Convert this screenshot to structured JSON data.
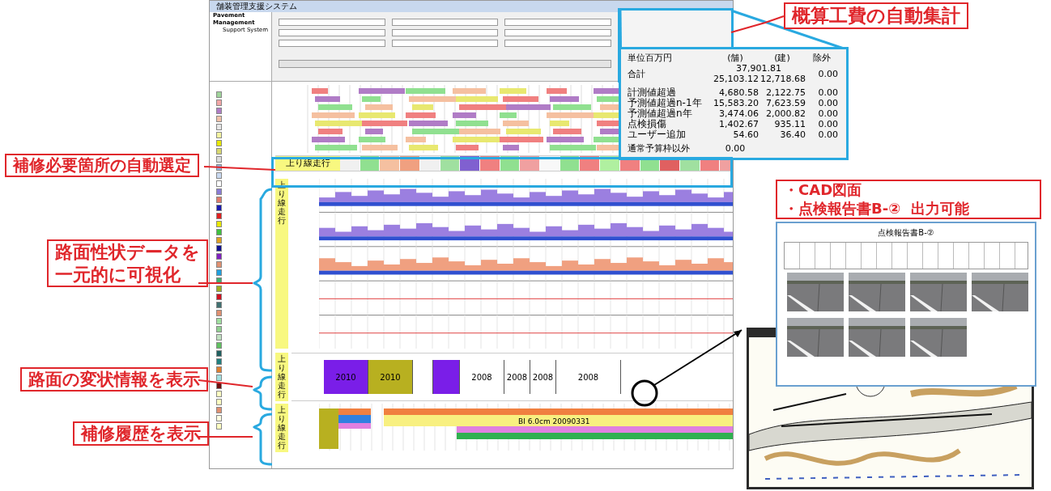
{
  "app": {
    "title": "舗装管理支援システム",
    "brand": [
      "Pavement Management",
      "Support System"
    ],
    "legend": [
      {
        "color": "#9fd49a"
      },
      {
        "color": "#f2a6a6"
      },
      {
        "color": "#b07cc6"
      },
      {
        "color": "#f0c0a8"
      },
      {
        "color": "#e6e6e6"
      },
      {
        "color": "#f4f4a0"
      },
      {
        "color": "#e8e800"
      },
      {
        "color": "#d8d870"
      },
      {
        "color": "#dddddd"
      },
      {
        "color": "#8fb4e0"
      },
      {
        "color": "#c8d8f0"
      },
      {
        "color": "#ffffff"
      },
      {
        "color": "#8a7cd6"
      },
      {
        "color": "#e07a6a"
      },
      {
        "color": "#1a1ab0"
      },
      {
        "color": "#e02020"
      },
      {
        "color": "#e8e800"
      },
      {
        "color": "#40c040"
      },
      {
        "color": "#e0a020"
      },
      {
        "color": "#101090"
      },
      {
        "color": "#8020c0"
      },
      {
        "color": "#e09070"
      },
      {
        "color": "#20a0e0"
      },
      {
        "color": "#40b070"
      },
      {
        "color": "#a0b020"
      },
      {
        "color": "#d01020"
      },
      {
        "color": "#407070"
      },
      {
        "color": "#e09070"
      },
      {
        "color": "#a0e0a0"
      },
      {
        "color": "#90d090"
      },
      {
        "color": "#c0e0c0"
      },
      {
        "color": "#60c060"
      },
      {
        "color": "#206060"
      },
      {
        "color": "#208080"
      },
      {
        "color": "#e08030"
      },
      {
        "color": "#a0e0e0"
      },
      {
        "color": "#701010"
      },
      {
        "color": "#ffffc0"
      },
      {
        "color": "#ffffc0"
      },
      {
        "color": "#e09070"
      },
      {
        "color": "#ffffe0"
      },
      {
        "color": "#ffffc0"
      }
    ],
    "repair_plan": {
      "lane": "上り線走行",
      "segments": [
        {
          "color": "#f0f0f0"
        },
        {
          "color": "#90e090"
        },
        {
          "color": "#f5c0a0"
        },
        {
          "color": "#f0a080"
        },
        {
          "color": "#f0f0f0"
        },
        {
          "color": "#a0e0a0"
        },
        {
          "color": "#8060d0"
        },
        {
          "color": "#f08080"
        },
        {
          "color": "#90e090"
        },
        {
          "color": "#f0a0a0"
        },
        {
          "color": "#f8f8f8"
        },
        {
          "color": "#90e090"
        },
        {
          "color": "#f08080"
        },
        {
          "color": "#b0f0a0"
        },
        {
          "color": "#f08080"
        },
        {
          "color": "#90e090"
        },
        {
          "color": "#e06060"
        },
        {
          "color": "#a0e0a0"
        },
        {
          "color": "#f08080"
        },
        {
          "color": "#f0a0a0"
        }
      ]
    },
    "survey": {
      "lane": "上り線走行"
    },
    "deformation": {
      "lane": "上り線走行",
      "blocks": [
        {
          "label": "2010",
          "color": "#7a1ee8"
        },
        {
          "label": "2010",
          "color": "#b8b020"
        },
        {
          "color": "#ffffff"
        },
        {
          "color": "#7a1ee8"
        },
        {
          "label": "2008",
          "color": "#ffffff"
        },
        {
          "label": "2008",
          "color": "#ffffff"
        },
        {
          "label": "2008",
          "color": "#ffffff"
        },
        {
          "label": "2008",
          "color": "#ffffff"
        }
      ]
    },
    "history": {
      "lane": "上り線走行",
      "label": "BI 6.0cm 20090331"
    }
  },
  "cost_summary": {
    "header": [
      "単位百万円",
      "(舗)",
      "(建)",
      "除外"
    ],
    "total_label": "合計",
    "total_combined": "37,901.81",
    "total_values": [
      "25,103.12",
      "12,718.68"
    ],
    "total_excluded": "0.00",
    "rows": [
      {
        "label": "計測値超過",
        "values": [
          "4,680.58",
          "2,122.75",
          "0.00"
        ]
      },
      {
        "label": "予測値超過n-1年",
        "values": [
          "15,583.20",
          "7,623.59",
          "0.00"
        ]
      },
      {
        "label": "予測値超過n年",
        "values": [
          "3,474.06",
          "2,000.82",
          "0.00"
        ]
      },
      {
        "label": "点検損傷",
        "values": [
          "1,402.67",
          "935.11",
          "0.00"
        ]
      },
      {
        "label": "ユーザー追加",
        "values": [
          "54.60",
          "36.40",
          "0.00"
        ]
      }
    ],
    "footer_label": "通常予算枠以外",
    "footer_value": "0.00"
  },
  "report": {
    "title": "点検報告書B-②"
  },
  "callouts": [
    {
      "lines": [
        "概算工費の自動集計"
      ]
    },
    {
      "lines": [
        "補修必要箇所の自動選定"
      ]
    },
    {
      "lines": [
        "路面性状データを",
        "一元的に可視化"
      ]
    },
    {
      "lines": [
        "路面の変状情報を表示"
      ]
    },
    {
      "lines": [
        "補修履歴を表示"
      ]
    },
    {
      "lines": [
        "・CAD図面",
        "・点検報告書B-②  出力可能"
      ]
    }
  ]
}
